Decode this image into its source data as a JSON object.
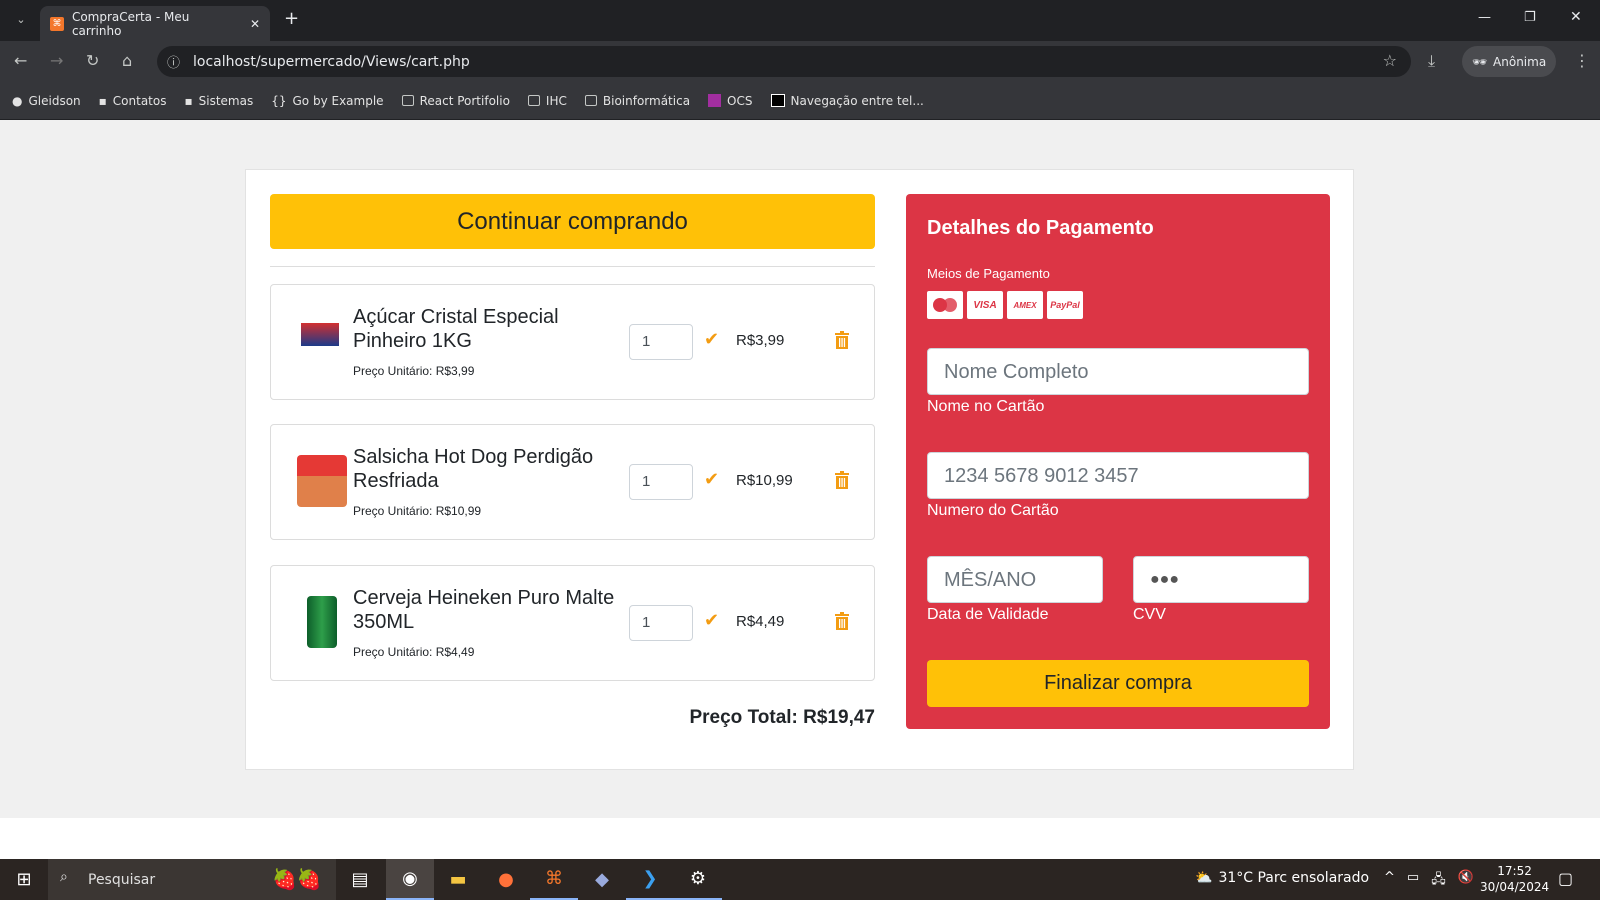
{
  "browser": {
    "tab_title": "CompraCerta - Meu carrinho",
    "url": "localhost/supermercado/Views/cart.php",
    "profile": "Anônima",
    "bookmarks": [
      "Gleidson",
      "Contatos",
      "Sistemas",
      "Go by Example",
      "React Portifolio",
      "IHC",
      "Bioinformática",
      "OCS",
      "Navegação entre tel..."
    ]
  },
  "cart": {
    "continue_label": "Continuar comprando",
    "items": [
      {
        "name": "Açúcar Cristal Especial Pinheiro 1KG",
        "unit_price": "Preço Unitário: R$3,99",
        "qty": "1",
        "price": "R$3,99",
        "color": "#d32f2f"
      },
      {
        "name": "Salsicha Hot Dog Perdigão Resfriada",
        "unit_price": "Preço Unitário: R$10,99",
        "qty": "1",
        "price": "R$10,99",
        "color": "#e0602a"
      },
      {
        "name": "Cerveja Heineken Puro Malte 350ML",
        "unit_price": "Preço Unitário: R$4,49",
        "qty": "1",
        "price": "R$4,49",
        "color": "#1e7d32"
      }
    ],
    "total": "Preço Total: R$19,47"
  },
  "payment": {
    "title": "Detalhes do Pagamento",
    "methods_label": "Meios de Pagamento",
    "methods": [
      "MC",
      "VISA",
      "AMEX",
      "PayPal"
    ],
    "name_placeholder": "Nome Completo",
    "name_label": "Nome no Cartão",
    "number_placeholder": "1234 5678 9012 3457",
    "number_label": "Numero do Cartão",
    "expiry_placeholder": "MÊS/ANO",
    "expiry_label": "Data de Validade",
    "cvv_value": "●●●",
    "cvv_label": "CVV",
    "submit_label": "Finalizar compra"
  },
  "taskbar": {
    "search": "Pesquisar",
    "weather": "31°C  Parc ensolarado",
    "time": "17:52",
    "date": "30/04/2024"
  }
}
